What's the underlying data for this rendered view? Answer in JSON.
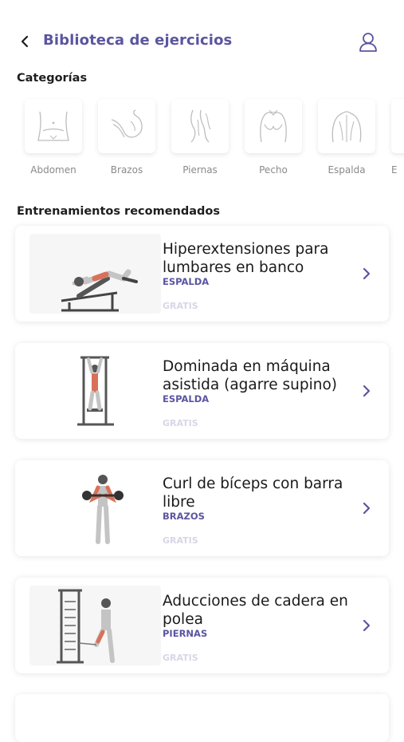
{
  "header": {
    "title": "Biblioteca de ejercicios"
  },
  "sections": {
    "categories_title": "Categorías",
    "recommended_title": "Entrenamientos recomendados"
  },
  "categories": [
    {
      "label": "Abdomen",
      "icon": "abdomen-icon"
    },
    {
      "label": "Brazos",
      "icon": "arm-icon"
    },
    {
      "label": "Piernas",
      "icon": "legs-icon"
    },
    {
      "label": "Pecho",
      "icon": "chest-icon"
    },
    {
      "label": "Espalda",
      "icon": "back-icon"
    },
    {
      "label": "E",
      "icon": "partial-category-icon"
    }
  ],
  "workouts": [
    {
      "name": "Hiperextensiones para lumbares en banco",
      "category": "ESPALDA",
      "price": "GRATIS"
    },
    {
      "name": "Dominada en máquina asistida (agarre supino)",
      "category": "ESPALDA",
      "price": "GRATIS"
    },
    {
      "name": "Curl de bíceps con barra libre",
      "category": "BRAZOS",
      "price": "GRATIS"
    },
    {
      "name": "Aducciones de cadera en polea",
      "category": "PIERNAS",
      "price": "GRATIS"
    }
  ],
  "colors": {
    "accent": "#5B55A0",
    "price": "#d8d6e6",
    "muted": "#8a8a8a"
  }
}
